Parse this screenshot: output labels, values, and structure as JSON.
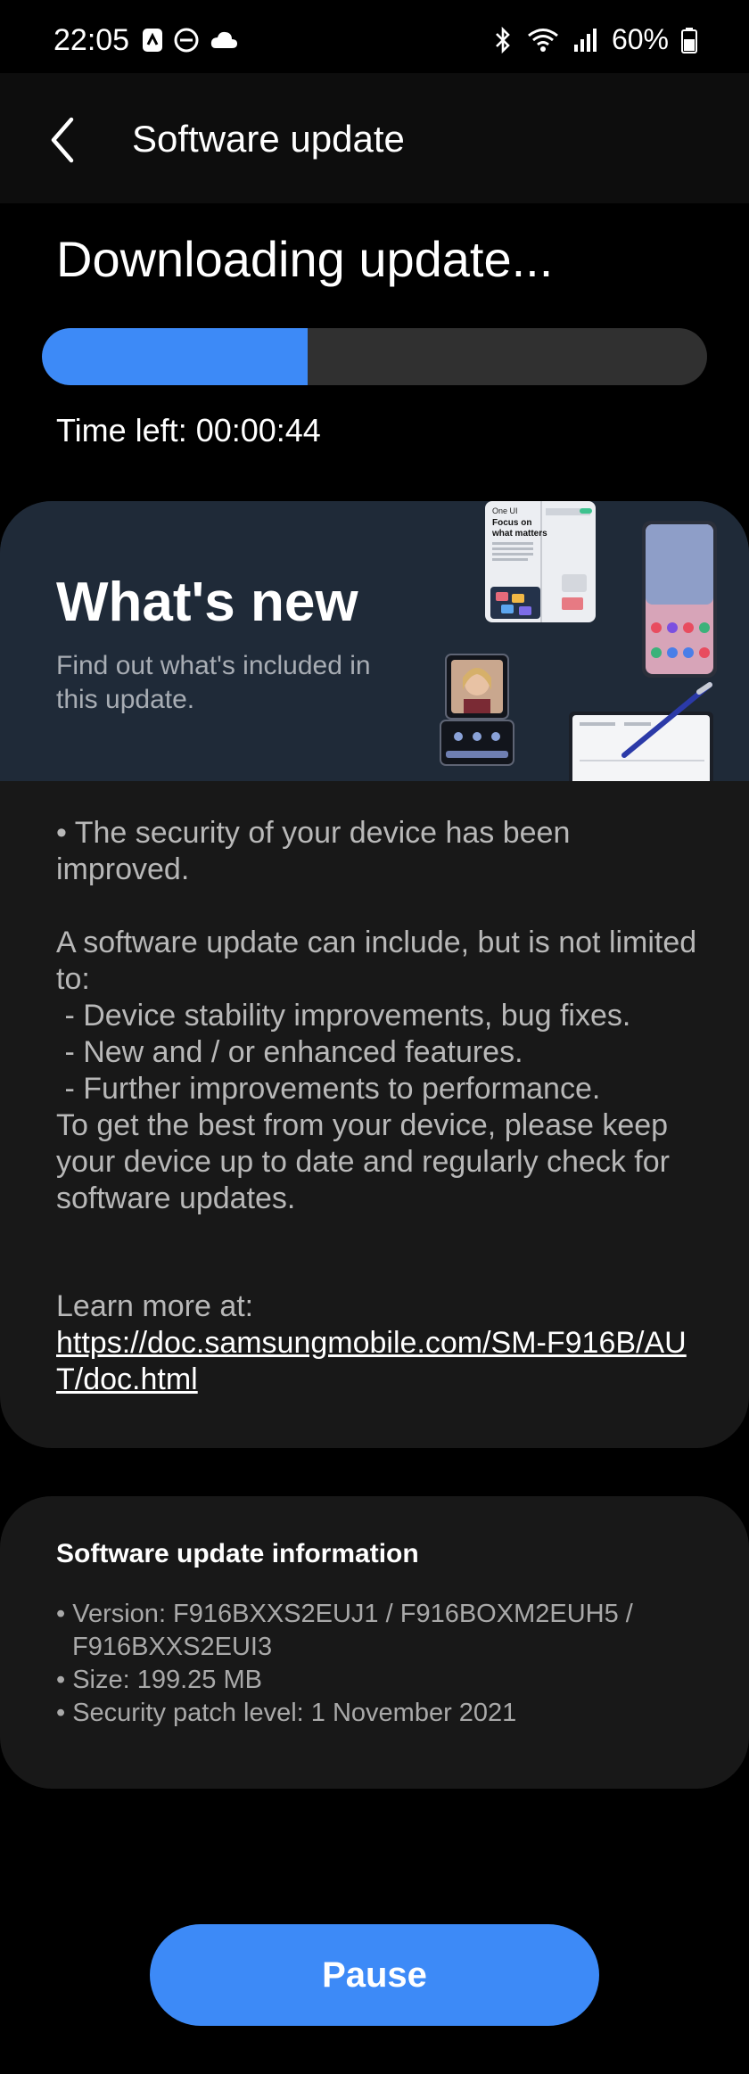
{
  "status_bar": {
    "time": "22:05",
    "battery": "60%",
    "icons": [
      "nfc-icon",
      "dnd-icon",
      "cloud-icon",
      "bluetooth-icon",
      "wifi-icon",
      "signal-icon",
      "battery-icon"
    ]
  },
  "app_bar": {
    "title": "Software update",
    "back_icon": "chevron-left-icon"
  },
  "download": {
    "heading": "Downloading update...",
    "progress_fraction": 0.4,
    "time_left": "Time left: 00:00:44",
    "bar_color": "#3d8af7",
    "track_color": "#303030"
  },
  "whats_new": {
    "title": "What's new",
    "subtitle": "Find out what's included in this update.",
    "illustration_text": [
      "One UI",
      "Focus on",
      "what matters"
    ],
    "notes": {
      "security": "• The security of your device has been improved.",
      "intro": "A software update can include, but is not limited to:",
      "items": [
        " - Device stability improvements, bug fixes.",
        " - New and / or enhanced features.",
        " - Further improvements to performance."
      ],
      "advice": "To get the best from your device, please keep your device up to date and regularly check for software updates.",
      "learn_more_label": "Learn more at:",
      "learn_more_url": "https://doc.samsungmobile.com/SM-F916B/AUT/doc.html"
    }
  },
  "info": {
    "title": "Software update information",
    "items": [
      "• Version: F916BXXS2EUJ1 / F916BOXM2EUH5 / F916BXXS2EUI3",
      "• Size: 199.25 MB",
      "• Security patch level: 1 November 2021"
    ]
  },
  "actions": {
    "pause_label": "Pause"
  },
  "colors": {
    "accent": "#3d8af7",
    "background": "#000000",
    "card": "#181818",
    "banner": "#1f2a38"
  }
}
